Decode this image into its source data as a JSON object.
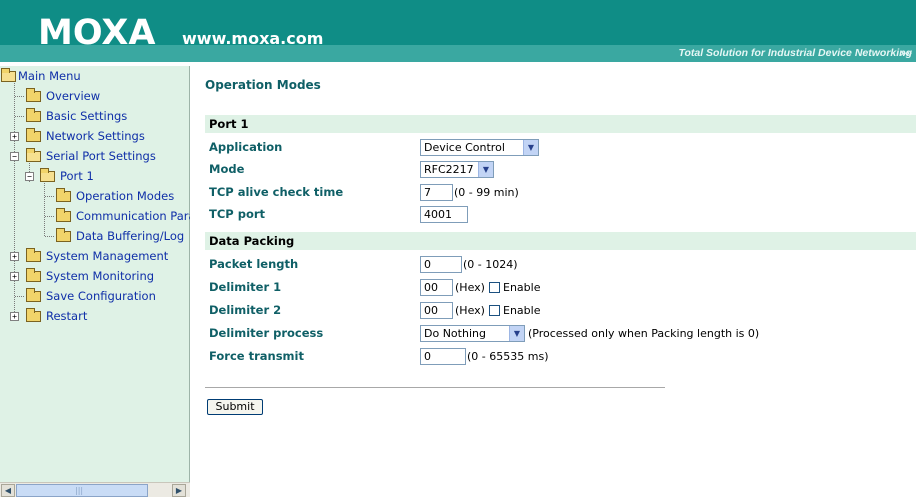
{
  "header": {
    "logo": "MOXA",
    "url": "www.moxa.com",
    "tagline": "Total Solution for Industrial Device Networking",
    "tagline_icon": "double-chevron-right-icon"
  },
  "tree": {
    "main_menu": "Main Menu",
    "items": {
      "overview": "Overview",
      "basic_settings": "Basic Settings",
      "network_settings": "Network Settings",
      "serial_port_settings": "Serial Port Settings",
      "port1": "Port 1",
      "operation_modes": "Operation Modes",
      "communication_params": "Communication Para",
      "data_buffering": "Data Buffering/Log",
      "system_management": "System Management",
      "system_monitoring": "System Monitoring",
      "save_configuration": "Save Configuration",
      "restart": "Restart"
    },
    "scroll_center": "|||"
  },
  "main": {
    "title": "Operation Modes",
    "port_section": "Port 1",
    "fields": {
      "application": {
        "label": "Application",
        "value": "Device Control"
      },
      "mode": {
        "label": "Mode",
        "value": "RFC2217"
      },
      "tcp_alive": {
        "label": "TCP alive check time",
        "value": "7",
        "note": "(0 - 99 min)"
      },
      "tcp_port": {
        "label": "TCP port",
        "value": "4001"
      }
    },
    "packing_section": "Data Packing",
    "packing": {
      "packet_length": {
        "label": "Packet length",
        "value": "0",
        "note": "(0 - 1024)"
      },
      "delimiter1": {
        "label": "Delimiter 1",
        "value": "00",
        "hex": "(Hex)",
        "enable": "Enable"
      },
      "delimiter2": {
        "label": "Delimiter 2",
        "value": "00",
        "hex": "(Hex)",
        "enable": "Enable"
      },
      "delimiter_process": {
        "label": "Delimiter process",
        "value": "Do Nothing",
        "note": "(Processed only when Packing length is 0)"
      },
      "force_transmit": {
        "label": "Force transmit",
        "value": "0",
        "note": "(0 - 65535 ms)"
      }
    },
    "submit": "Submit"
  },
  "colors": {
    "header": "#0f8d86",
    "sidebar": "#dff2e6",
    "label": "#0f5f66",
    "tree_text": "#0f2fa8"
  }
}
